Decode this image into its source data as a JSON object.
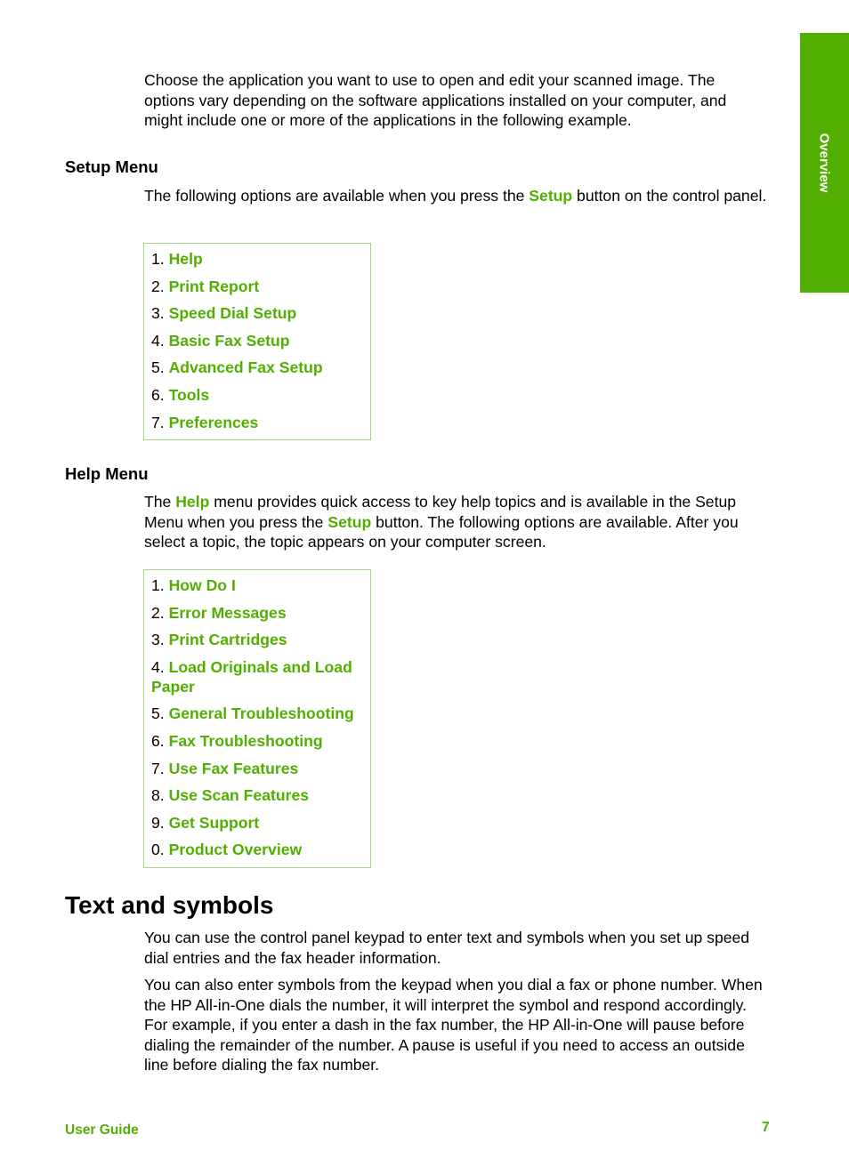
{
  "side_tab": {
    "label": "Overview"
  },
  "intro": {
    "text": "Choose the application you want to use to open and edit your scanned image. The options vary depending on the software applications installed on your computer, and might include one or more of the applications in the following example."
  },
  "setup_menu": {
    "heading": "Setup Menu",
    "desc_pre": "The following options are available when you press the ",
    "desc_link": "Setup",
    "desc_post": " button on the control panel.",
    "items": [
      {
        "num": "1.",
        "label": "Help"
      },
      {
        "num": "2.",
        "label": "Print Report"
      },
      {
        "num": "3.",
        "label": "Speed Dial Setup"
      },
      {
        "num": "4.",
        "label": "Basic Fax Setup"
      },
      {
        "num": "5.",
        "label": "Advanced Fax Setup"
      },
      {
        "num": "6.",
        "label": "Tools"
      },
      {
        "num": "7.",
        "label": "Preferences"
      }
    ]
  },
  "help_menu": {
    "heading": "Help Menu",
    "desc_1": "The ",
    "desc_link1": "Help",
    "desc_2": " menu provides quick access to key help topics and is available in the Setup Menu when you press the ",
    "desc_link2": "Setup",
    "desc_3": " button. The following options are available. After you select a topic, the topic appears on your computer screen.",
    "items": [
      {
        "num": "1.",
        "label": "How Do I"
      },
      {
        "num": "2.",
        "label": "Error Messages"
      },
      {
        "num": "3.",
        "label": "Print Cartridges"
      },
      {
        "num": "4.",
        "label": "Load Originals and Load Paper"
      },
      {
        "num": "5.",
        "label": "General Troubleshooting"
      },
      {
        "num": "6.",
        "label": "Fax Troubleshooting"
      },
      {
        "num": "7.",
        "label": "Use Fax Features"
      },
      {
        "num": "8.",
        "label": "Use Scan Features"
      },
      {
        "num": "9.",
        "label": "Get Support"
      },
      {
        "num": "0.",
        "label": "Product Overview"
      }
    ]
  },
  "text_symbols": {
    "heading": "Text and symbols",
    "para1": "You can use the control panel keypad to enter text and symbols when you set up speed dial entries and the fax header information.",
    "para2": "You can also enter symbols from the keypad when you dial a fax or phone number. When the HP All-in-One dials the number, it will interpret the symbol and respond accordingly. For example, if you enter a dash in the fax number, the HP All-in-One will pause before dialing the remainder of the number. A pause is useful if you need to access an outside line before dialing the fax number."
  },
  "footer": {
    "left": "User Guide",
    "page": "7"
  },
  "colors": {
    "accent": "#52ae00",
    "box_border": "#a6d67f"
  }
}
